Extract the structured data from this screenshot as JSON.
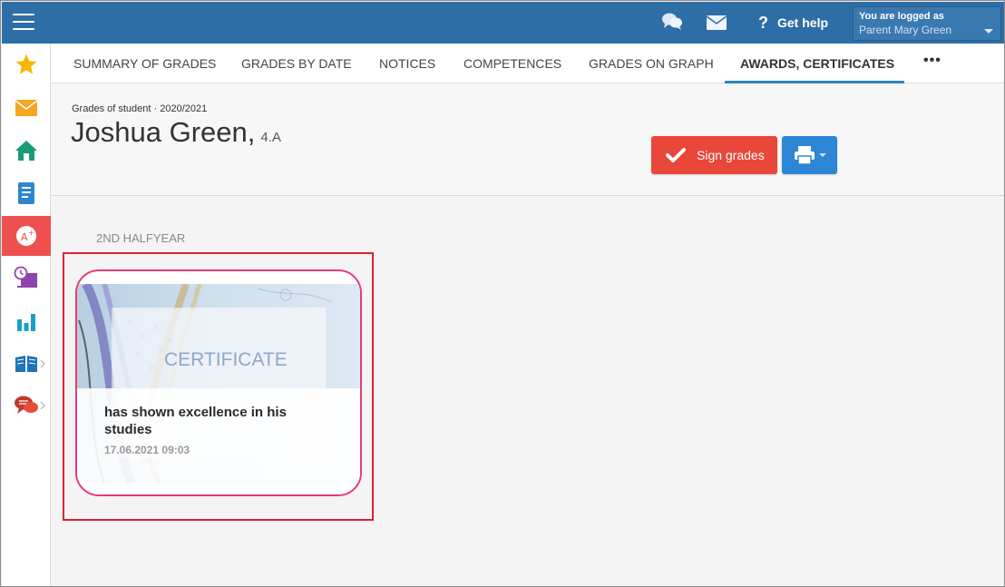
{
  "topbar": {
    "help_label": "Get help",
    "user_line1": "You are logged as",
    "user_line2": "Parent Mary Green"
  },
  "tabs": [
    {
      "label": "SUMMARY OF GRADES"
    },
    {
      "label": "GRADES BY DATE"
    },
    {
      "label": "NOTICES"
    },
    {
      "label": "COMPETENCES"
    },
    {
      "label": "GRADES ON GRAPH"
    },
    {
      "label": "AWARDS, CERTIFICATES"
    }
  ],
  "header": {
    "subtitle": "Grades of student · 2020/2021",
    "student_name": "Joshua Green,",
    "student_class": "4.A",
    "sign_button": "Sign grades"
  },
  "section": {
    "label": "2ND HALFYEAR"
  },
  "card": {
    "image_text": "CERTIFICATE",
    "title": "has shown excellence in his studies",
    "date": "17.06.2021 09:03"
  },
  "colors": {
    "topbar": "#2e6ea6",
    "active_side": "#ee5050",
    "sign_button": "#e8473a",
    "print_button": "#2e86d6",
    "card_border": "#e8397d",
    "highlight": "#e02030"
  }
}
